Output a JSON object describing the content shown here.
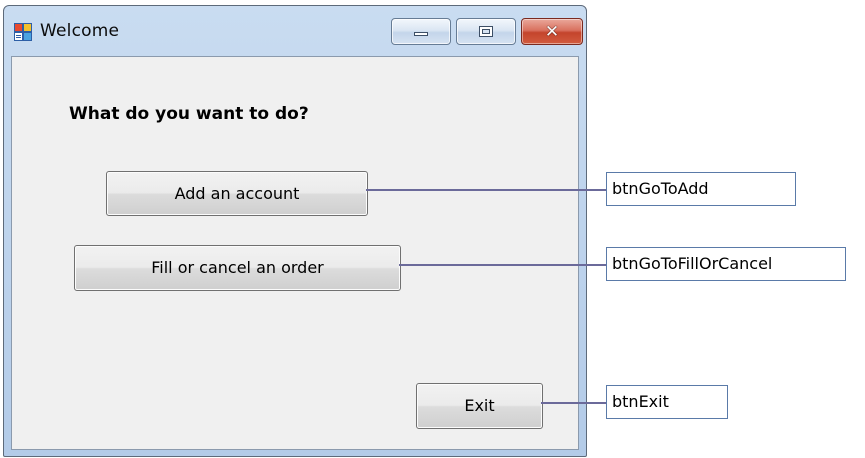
{
  "window": {
    "title": "Welcome",
    "app_icon": "winforms-app-icon",
    "controls": {
      "minimize": "minimize-icon",
      "maximize": "maximize-icon",
      "close_glyph": "✕"
    }
  },
  "form": {
    "prompt": "What do you want to do?",
    "buttons": {
      "add_account": "Add an account",
      "fill_cancel": "Fill or cancel an order",
      "exit": "Exit"
    }
  },
  "callouts": {
    "add": "btnGoToAdd",
    "fill_cancel": "btnGoToFillOrCancel",
    "exit": "btnExit"
  },
  "colors": {
    "callout_line": "#6b6a9a",
    "callout_border": "#5a7aa8",
    "client_bg": "#f0f0f0",
    "close_button": "#c4442c"
  }
}
